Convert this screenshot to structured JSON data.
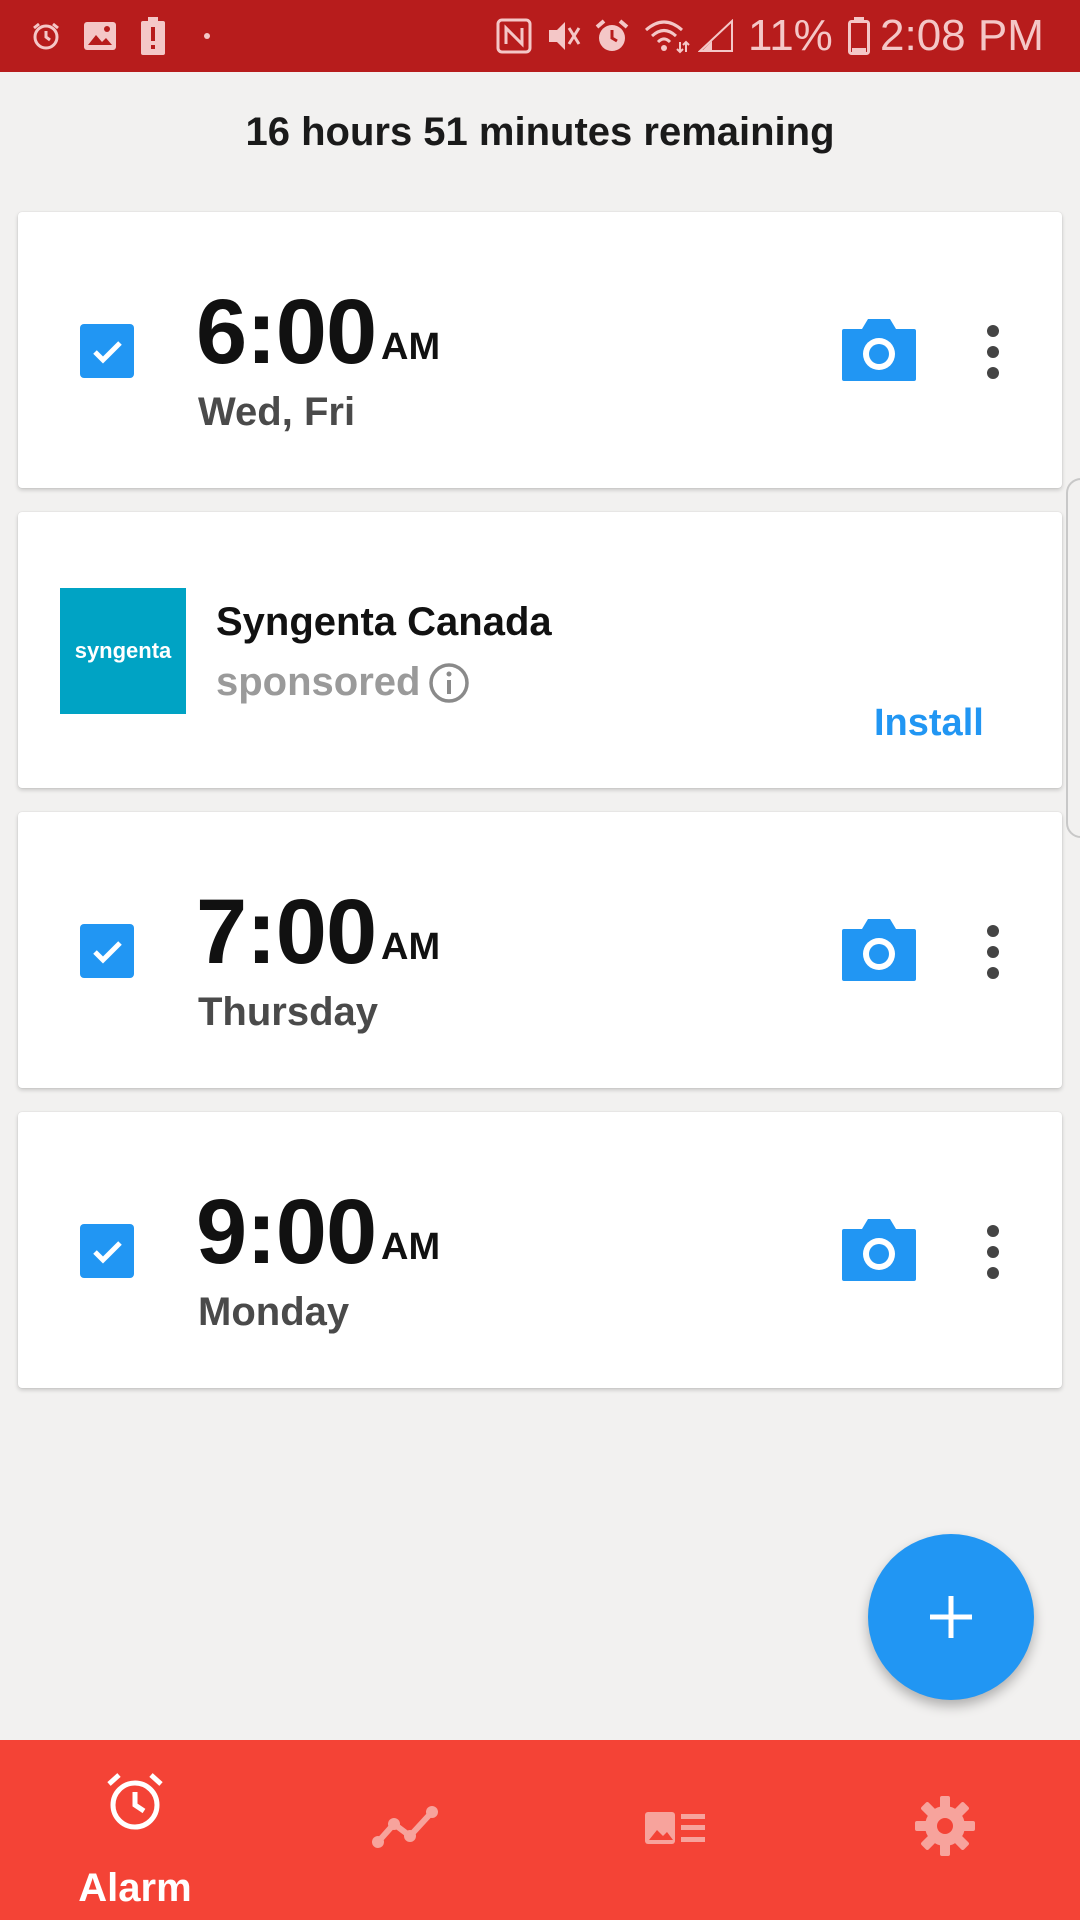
{
  "status_bar": {
    "battery": "11%",
    "time": "2:08 PM",
    "icons": [
      "alarm-icon",
      "image-icon",
      "battery-alert-icon",
      "dot-icon",
      "nfc-icon",
      "vibrate-icon",
      "alarm-clock-icon",
      "wifi-icon",
      "signal-icon",
      "battery-icon"
    ]
  },
  "header": {
    "remaining": "16 hours 51 minutes remaining"
  },
  "alarms": [
    {
      "time": "6:00",
      "ampm": "AM",
      "days": "Wed, Fri",
      "enabled": true
    },
    {
      "time": "7:00",
      "ampm": "AM",
      "days": "Thursday",
      "enabled": true
    },
    {
      "time": "9:00",
      "ampm": "AM",
      "days": "Monday",
      "enabled": true
    }
  ],
  "ad": {
    "logo_text": "syngenta",
    "title": "Syngenta Canada",
    "sponsored": "sponsored",
    "install": "Install"
  },
  "bottom_nav": {
    "items": [
      {
        "label": "Alarm",
        "icon": "alarm-clock-icon",
        "active": true
      },
      {
        "label": "",
        "icon": "trend-chart-icon",
        "active": false
      },
      {
        "label": "",
        "icon": "news-card-icon",
        "active": false
      },
      {
        "label": "",
        "icon": "gear-icon",
        "active": false
      }
    ]
  },
  "colors": {
    "status_bar": "#b71c1c",
    "accent": "#2196f3",
    "nav_bar": "#f44336",
    "background": "#f2f1f0"
  }
}
